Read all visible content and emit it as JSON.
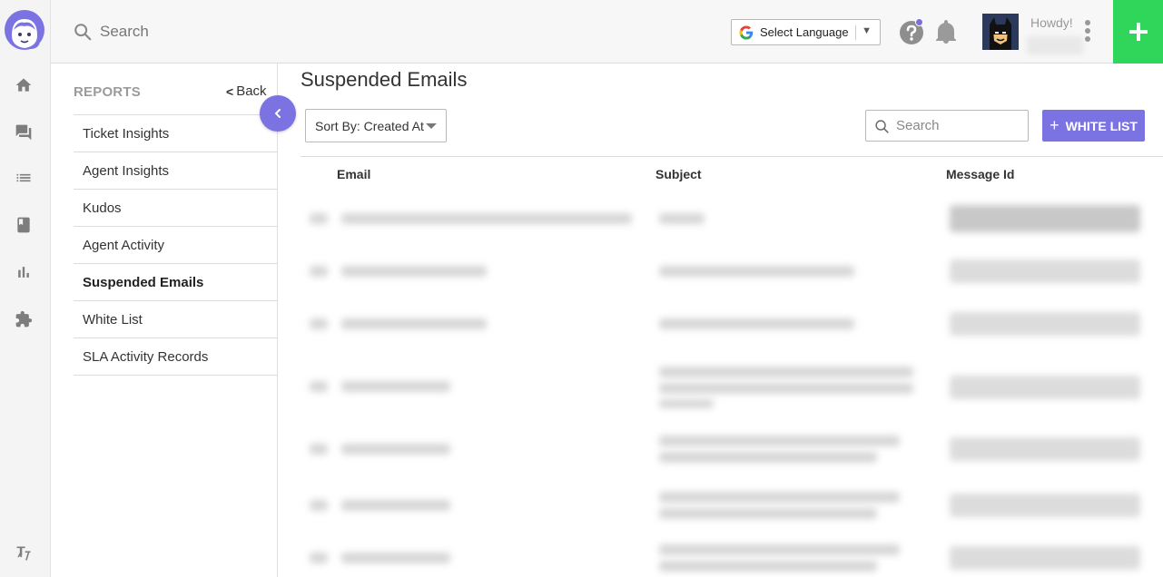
{
  "header": {
    "search_placeholder": "Search",
    "language_label": "Select Language",
    "greeting": "Howdy!"
  },
  "sidebar": {
    "section_title": "REPORTS",
    "back_label": "Back",
    "items": [
      {
        "label": "Ticket Insights"
      },
      {
        "label": "Agent Insights"
      },
      {
        "label": "Kudos"
      },
      {
        "label": "Agent Activity"
      },
      {
        "label": "Suspended Emails",
        "active": true
      },
      {
        "label": "White List"
      },
      {
        "label": "SLA Activity Records"
      }
    ]
  },
  "main": {
    "title": "Suspended Emails",
    "sort_label": "Sort By: Created At",
    "search_placeholder": "Search",
    "whitelist_button": "WHITE LIST",
    "columns": [
      "Email",
      "Subject",
      "Message Id"
    ]
  },
  "colors": {
    "accent": "#7b73e2",
    "create": "#2fd65a"
  },
  "icons": {
    "rail": [
      "home-icon",
      "chat-icon",
      "list-icon",
      "book-icon",
      "reports-icon",
      "puzzle-icon",
      "translate-icon"
    ]
  }
}
